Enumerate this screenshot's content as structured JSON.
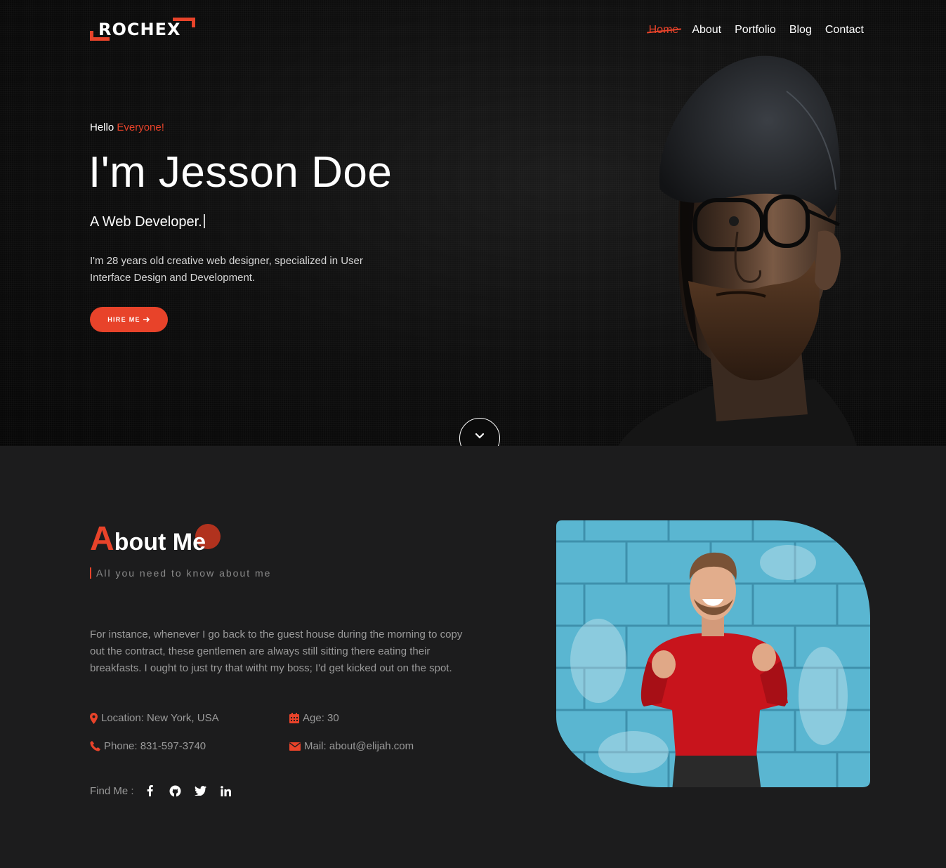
{
  "brand": {
    "logo": "ROCHEX"
  },
  "nav": {
    "items": [
      {
        "label": "Home",
        "active": true
      },
      {
        "label": "About"
      },
      {
        "label": "Portfolio"
      },
      {
        "label": "Blog"
      },
      {
        "label": "Contact"
      }
    ]
  },
  "hero": {
    "greeting": "Hello",
    "greeting_accent": "Everyone!",
    "name": "I'm Jesson Doe",
    "role": "A Web Developer.",
    "description": "I'm 28 years old creative web designer, specialized in User Interface Design and Development.",
    "cta": "HIRE ME"
  },
  "about": {
    "title_initial": "A",
    "title_rest": "bout Me",
    "subtitle": "All you need to know about me",
    "text": "For instance, whenever I go back to the guest house during the morning to copy out the contract, these gentlemen are always still sitting there eating their breakfasts. I ought to just try that witht my boss; I'd get kicked out on the spot.",
    "location": "Location: New York, USA",
    "age": "Age: 30",
    "phone": "Phone: 831-597-3740",
    "mail": "Mail: about@elijah.com",
    "find_me": "Find Me :",
    "socials": [
      "facebook-icon",
      "github-icon",
      "twitter-icon",
      "linkedin-icon"
    ]
  },
  "colors": {
    "accent": "#e8432a",
    "background": "#1c1c1d",
    "hero": "#0d0d0d"
  }
}
